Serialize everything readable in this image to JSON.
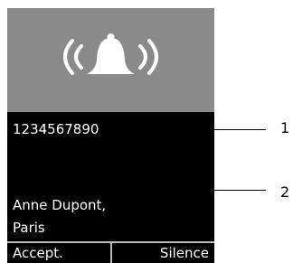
{
  "call": {
    "number": "1234567890",
    "name": "Anne Dupont,",
    "location": "Paris"
  },
  "icon": "ringing-bell-icon",
  "softkeys": {
    "left": "Accept.",
    "right": "Silence"
  },
  "callouts": [
    "1",
    "2"
  ],
  "colors": {
    "ring_area_bg": "#8a8a8a",
    "screen_bg": "#000000",
    "text": "#ffffff"
  }
}
